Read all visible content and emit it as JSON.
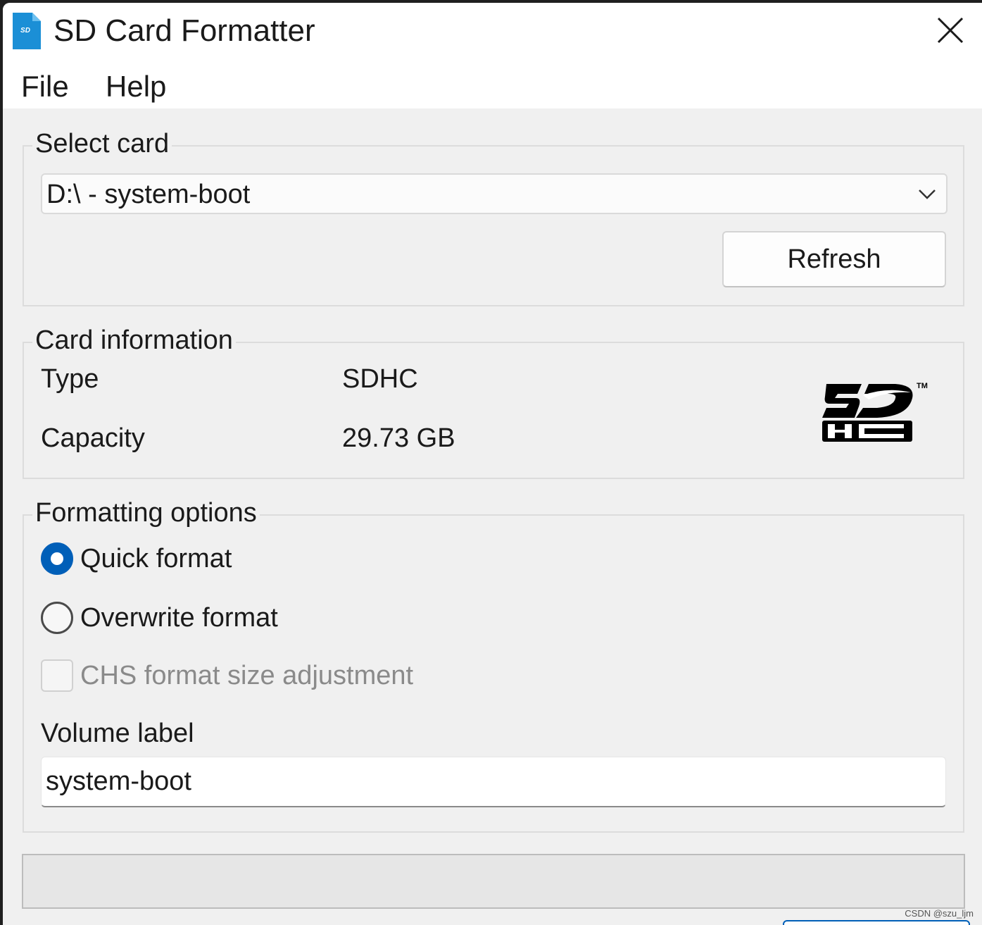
{
  "window": {
    "title": "SD Card Formatter",
    "icon": "sd-card-app-icon",
    "icon_text": "SD"
  },
  "menu": {
    "items": [
      "File",
      "Help"
    ]
  },
  "select_card": {
    "legend": "Select card",
    "selected_value": "D:\\ - system-boot",
    "refresh_label": "Refresh"
  },
  "card_info": {
    "legend": "Card information",
    "type_label": "Type",
    "type_value": "SDHC",
    "capacity_label": "Capacity",
    "capacity_value": "29.73 GB",
    "logo": "sdhc-logo",
    "logo_trademark": "TM"
  },
  "formatting": {
    "legend": "Formatting options",
    "options": [
      {
        "label": "Quick format",
        "checked": true
      },
      {
        "label": "Overwrite format",
        "checked": false
      }
    ],
    "chs_label": "CHS format size adjustment",
    "chs_enabled": false,
    "chs_checked": false,
    "volume_label_title": "Volume label",
    "volume_label_value": "system-boot"
  },
  "progress": {
    "value": 0
  },
  "watermark": "CSDN @szu_ljm",
  "colors": {
    "accent": "#005fb8",
    "window_bg": "#f0f0f0",
    "titlebar_bg": "#ffffff",
    "icon_blue": "#1b8fd6"
  }
}
